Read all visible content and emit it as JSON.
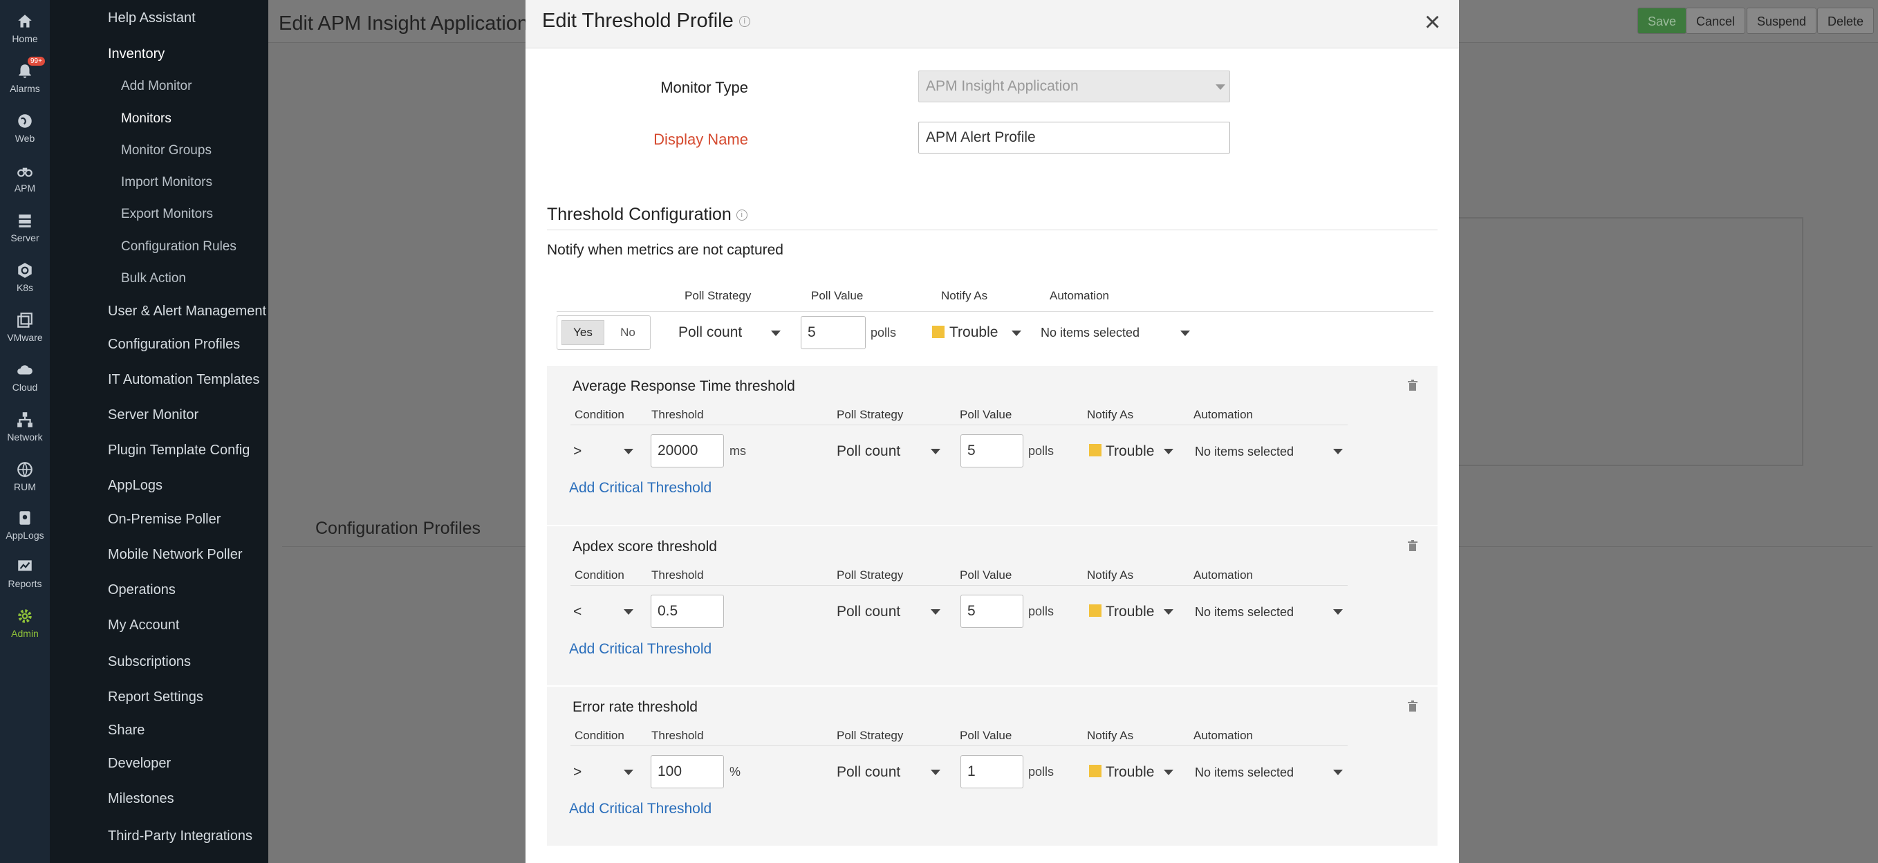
{
  "rail": [
    {
      "label": "Home",
      "icon": "home-icon"
    },
    {
      "label": "Alarms",
      "icon": "bell-icon",
      "badge": "99+"
    },
    {
      "label": "Web",
      "icon": "globe-icon"
    },
    {
      "label": "APM",
      "icon": "binoculars-icon"
    },
    {
      "label": "Server",
      "icon": "server-icon"
    },
    {
      "label": "K8s",
      "icon": "kubernetes-icon"
    },
    {
      "label": "VMware",
      "icon": "vm-icon"
    },
    {
      "label": "Cloud",
      "icon": "cloud-icon"
    },
    {
      "label": "Network",
      "icon": "network-icon"
    },
    {
      "label": "RUM",
      "icon": "rum-icon"
    },
    {
      "label": "AppLogs",
      "icon": "applogs-icon"
    },
    {
      "label": "Reports",
      "icon": "reports-icon"
    },
    {
      "label": "Admin",
      "icon": "gear-icon",
      "active": true
    }
  ],
  "nav": {
    "help": "Help Assistant",
    "inventory": "Inventory",
    "inventory_items": [
      "Add Monitor",
      "Monitors",
      "Monitor Groups",
      "Import Monitors",
      "Export Monitors",
      "Configuration Rules",
      "Bulk Action"
    ],
    "sections": [
      "User & Alert Management",
      "Configuration Profiles",
      "IT Automation Templates",
      "Server Monitor",
      "Plugin Template Config",
      "AppLogs",
      "On-Premise Poller",
      "Mobile Network Poller",
      "Operations",
      "My Account",
      "Subscriptions",
      "Report Settings",
      "Share",
      "Developer",
      "Milestones",
      "Third-Party Integrations"
    ]
  },
  "background": {
    "title": "Edit APM Insight Application",
    "buttons": {
      "save": "Save",
      "cancel": "Cancel",
      "suspend": "Suspend",
      "delete": "Delete"
    },
    "subtitle": "Configuration Profiles"
  },
  "modal": {
    "title": "Edit Threshold Profile",
    "monitor_type_label": "Monitor Type",
    "monitor_type_value": "APM Insight Application",
    "display_name_label": "Display Name",
    "display_name_value": "APM Alert Profile",
    "section_title": "Threshold Configuration",
    "notify_text": "Notify when metrics are not captured",
    "headers": {
      "condition": "Condition",
      "threshold": "Threshold",
      "poll_strategy": "Poll Strategy",
      "poll_value": "Poll Value",
      "notify_as": "Notify As",
      "automation": "Automation"
    },
    "no_data_row": {
      "yes": "Yes",
      "no": "No",
      "poll_strategy": "Poll count",
      "poll_value": "5",
      "unit": "polls",
      "notify_as": "Trouble",
      "automation": "No items selected"
    },
    "thresholds": [
      {
        "title": "Average Response Time threshold",
        "condition": ">",
        "value": "20000",
        "unit": "ms",
        "poll_strategy": "Poll count",
        "poll_value": "5",
        "poll_unit": "polls",
        "notify_as": "Trouble",
        "automation": "No items selected",
        "add": "Add Critical Threshold"
      },
      {
        "title": "Apdex score threshold",
        "condition": "<",
        "value": "0.5",
        "unit": "",
        "poll_strategy": "Poll count",
        "poll_value": "5",
        "poll_unit": "polls",
        "notify_as": "Trouble",
        "automation": "No items selected",
        "add": "Add Critical Threshold"
      },
      {
        "title": "Error rate threshold",
        "condition": ">",
        "value": "100",
        "unit": "%",
        "poll_strategy": "Poll count",
        "poll_value": "1",
        "poll_unit": "polls",
        "notify_as": "Trouble",
        "automation": "No items selected",
        "add": "Add Critical Threshold"
      }
    ]
  },
  "colors": {
    "trouble": "#f2c13a",
    "link": "#2a6ebb",
    "required": "#d54a2f",
    "admin_active": "#8fc23a"
  }
}
